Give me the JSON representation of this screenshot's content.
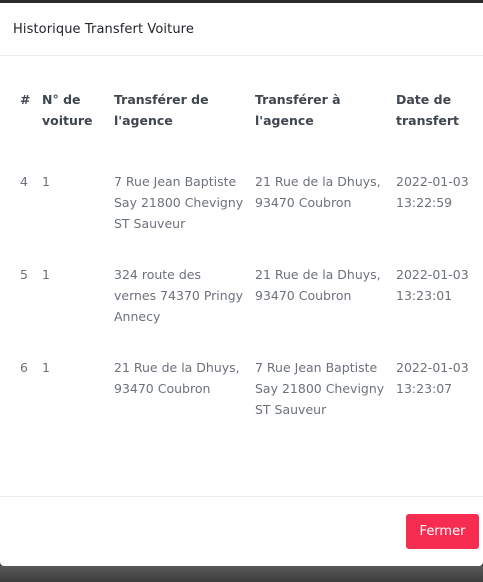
{
  "modal": {
    "title": "Historique Transfert Voiture",
    "close_label": "Fermer"
  },
  "table": {
    "headers": {
      "id": "#",
      "car": "N° de voiture",
      "from": "Transférer de l'agence",
      "to": "Transférer à l'agence",
      "date": "Date de transfert"
    },
    "rows": [
      {
        "id": "4",
        "car": "1",
        "from": "7 Rue Jean Baptiste Say 21800 Chevigny ST Sauveur",
        "to": "21 Rue de la Dhuys, 93470 Coubron",
        "date": "2022-01-03 13:22:59"
      },
      {
        "id": "5",
        "car": "1",
        "from": "324 route des vernes 74370 Pringy Annecy",
        "to": "21 Rue de la Dhuys, 93470 Coubron",
        "date": "2022-01-03 13:23:01"
      },
      {
        "id": "6",
        "car": "1",
        "from": "21 Rue de la Dhuys, 93470 Coubron",
        "to": "7 Rue Jean Baptiste Say 21800 Chevigny ST Sauveur",
        "date": "2022-01-03 13:23:07"
      }
    ]
  },
  "colors": {
    "close_button": "#f62d51",
    "header_text": "#3f4650",
    "cell_text": "#6c727a"
  }
}
